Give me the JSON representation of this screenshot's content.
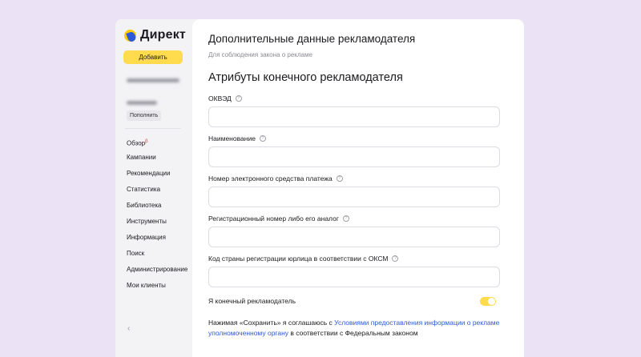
{
  "sidebar": {
    "logo_text": "Директ",
    "add_button": "Добавить",
    "topup_button": "Пополнить",
    "nav": [
      "Обзор",
      "Кампании",
      "Рекомендации",
      "Статистика",
      "Библиотека",
      "Инструменты",
      "Информация",
      "Поиск",
      "Администрирование",
      "Мои клиенты"
    ],
    "overview_badge": "β",
    "collapse_icon": "chevron-left-icon"
  },
  "main": {
    "title": "Дополнительные данные рекламодателя",
    "subtitle": "Для соблюдения закона о рекламе",
    "section_title": "Атрибуты конечного рекламодателя",
    "fields": [
      {
        "label": "ОКВЭД",
        "value": ""
      },
      {
        "label": "Наименование",
        "value": ""
      },
      {
        "label": "Номер электронного средства платежа",
        "value": ""
      },
      {
        "label": "Регистрационный номер либо его аналог",
        "value": ""
      },
      {
        "label": "Код страны регистрации юрлица в соответствии с ОКСМ",
        "value": ""
      }
    ],
    "info_glyph": "?",
    "end_advertiser_label": "Я конечный рекламодатель",
    "end_advertiser_on": true,
    "consent": {
      "prefix": "Нажимая «Сохранить» я соглашаюсь с ",
      "link": "Условиями предоставления информации о рекламе уполномоченному органу",
      "suffix": " в соответствии с Федеральным законом"
    }
  },
  "colors": {
    "accent": "#ffdb4d",
    "link": "#2e59d9",
    "page_bg": "#ebe3f5"
  }
}
